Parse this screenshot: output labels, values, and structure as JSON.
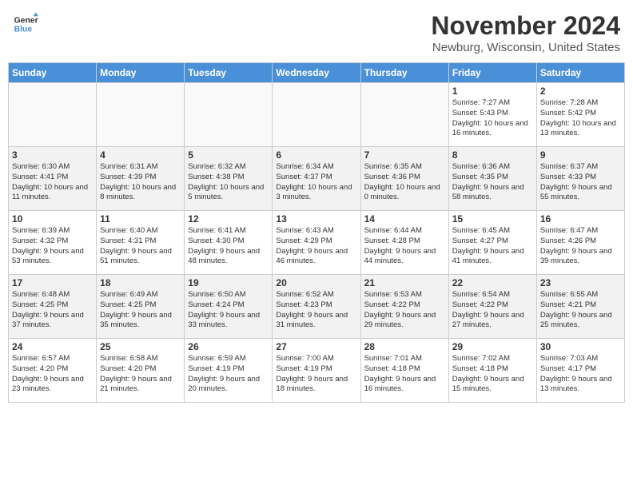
{
  "header": {
    "logo_line1": "General",
    "logo_line2": "Blue",
    "month_title": "November 2024",
    "location": "Newburg, Wisconsin, United States"
  },
  "days_of_week": [
    "Sunday",
    "Monday",
    "Tuesday",
    "Wednesday",
    "Thursday",
    "Friday",
    "Saturday"
  ],
  "weeks": [
    [
      {
        "day": "",
        "info": ""
      },
      {
        "day": "",
        "info": ""
      },
      {
        "day": "",
        "info": ""
      },
      {
        "day": "",
        "info": ""
      },
      {
        "day": "",
        "info": ""
      },
      {
        "day": "1",
        "info": "Sunrise: 7:27 AM\nSunset: 5:43 PM\nDaylight: 10 hours and 16 minutes."
      },
      {
        "day": "2",
        "info": "Sunrise: 7:28 AM\nSunset: 5:42 PM\nDaylight: 10 hours and 13 minutes."
      }
    ],
    [
      {
        "day": "3",
        "info": "Sunrise: 6:30 AM\nSunset: 4:41 PM\nDaylight: 10 hours and 11 minutes."
      },
      {
        "day": "4",
        "info": "Sunrise: 6:31 AM\nSunset: 4:39 PM\nDaylight: 10 hours and 8 minutes."
      },
      {
        "day": "5",
        "info": "Sunrise: 6:32 AM\nSunset: 4:38 PM\nDaylight: 10 hours and 5 minutes."
      },
      {
        "day": "6",
        "info": "Sunrise: 6:34 AM\nSunset: 4:37 PM\nDaylight: 10 hours and 3 minutes."
      },
      {
        "day": "7",
        "info": "Sunrise: 6:35 AM\nSunset: 4:36 PM\nDaylight: 10 hours and 0 minutes."
      },
      {
        "day": "8",
        "info": "Sunrise: 6:36 AM\nSunset: 4:35 PM\nDaylight: 9 hours and 58 minutes."
      },
      {
        "day": "9",
        "info": "Sunrise: 6:37 AM\nSunset: 4:33 PM\nDaylight: 9 hours and 55 minutes."
      }
    ],
    [
      {
        "day": "10",
        "info": "Sunrise: 6:39 AM\nSunset: 4:32 PM\nDaylight: 9 hours and 53 minutes."
      },
      {
        "day": "11",
        "info": "Sunrise: 6:40 AM\nSunset: 4:31 PM\nDaylight: 9 hours and 51 minutes."
      },
      {
        "day": "12",
        "info": "Sunrise: 6:41 AM\nSunset: 4:30 PM\nDaylight: 9 hours and 48 minutes."
      },
      {
        "day": "13",
        "info": "Sunrise: 6:43 AM\nSunset: 4:29 PM\nDaylight: 9 hours and 46 minutes."
      },
      {
        "day": "14",
        "info": "Sunrise: 6:44 AM\nSunset: 4:28 PM\nDaylight: 9 hours and 44 minutes."
      },
      {
        "day": "15",
        "info": "Sunrise: 6:45 AM\nSunset: 4:27 PM\nDaylight: 9 hours and 41 minutes."
      },
      {
        "day": "16",
        "info": "Sunrise: 6:47 AM\nSunset: 4:26 PM\nDaylight: 9 hours and 39 minutes."
      }
    ],
    [
      {
        "day": "17",
        "info": "Sunrise: 6:48 AM\nSunset: 4:25 PM\nDaylight: 9 hours and 37 minutes."
      },
      {
        "day": "18",
        "info": "Sunrise: 6:49 AM\nSunset: 4:25 PM\nDaylight: 9 hours and 35 minutes."
      },
      {
        "day": "19",
        "info": "Sunrise: 6:50 AM\nSunset: 4:24 PM\nDaylight: 9 hours and 33 minutes."
      },
      {
        "day": "20",
        "info": "Sunrise: 6:52 AM\nSunset: 4:23 PM\nDaylight: 9 hours and 31 minutes."
      },
      {
        "day": "21",
        "info": "Sunrise: 6:53 AM\nSunset: 4:22 PM\nDaylight: 9 hours and 29 minutes."
      },
      {
        "day": "22",
        "info": "Sunrise: 6:54 AM\nSunset: 4:22 PM\nDaylight: 9 hours and 27 minutes."
      },
      {
        "day": "23",
        "info": "Sunrise: 6:55 AM\nSunset: 4:21 PM\nDaylight: 9 hours and 25 minutes."
      }
    ],
    [
      {
        "day": "24",
        "info": "Sunrise: 6:57 AM\nSunset: 4:20 PM\nDaylight: 9 hours and 23 minutes."
      },
      {
        "day": "25",
        "info": "Sunrise: 6:58 AM\nSunset: 4:20 PM\nDaylight: 9 hours and 21 minutes."
      },
      {
        "day": "26",
        "info": "Sunrise: 6:59 AM\nSunset: 4:19 PM\nDaylight: 9 hours and 20 minutes."
      },
      {
        "day": "27",
        "info": "Sunrise: 7:00 AM\nSunset: 4:19 PM\nDaylight: 9 hours and 18 minutes."
      },
      {
        "day": "28",
        "info": "Sunrise: 7:01 AM\nSunset: 4:18 PM\nDaylight: 9 hours and 16 minutes."
      },
      {
        "day": "29",
        "info": "Sunrise: 7:02 AM\nSunset: 4:18 PM\nDaylight: 9 hours and 15 minutes."
      },
      {
        "day": "30",
        "info": "Sunrise: 7:03 AM\nSunset: 4:17 PM\nDaylight: 9 hours and 13 minutes."
      }
    ]
  ]
}
